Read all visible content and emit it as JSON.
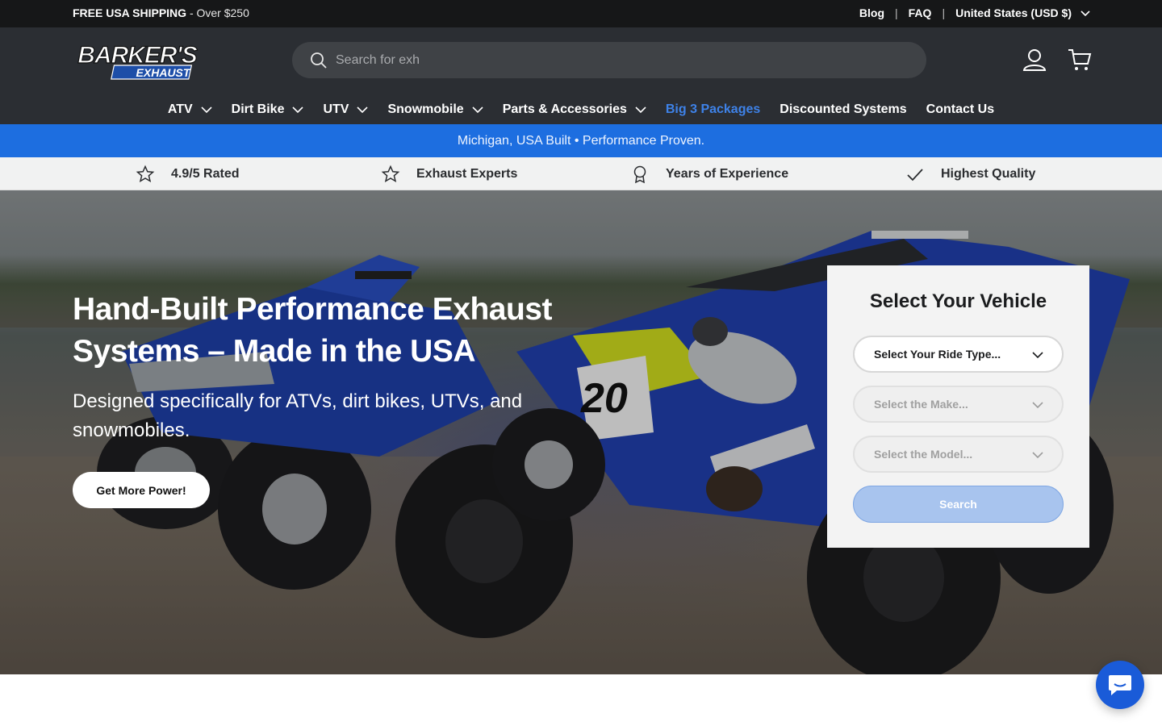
{
  "announcement": {
    "shipping_bold": "FREE USA SHIPPING",
    "shipping_rest": " - Over $250",
    "links": [
      "Blog",
      "FAQ"
    ],
    "region": "United States (USD $)"
  },
  "header": {
    "logo_top": "BARKER'S",
    "logo_bottom": "EXHAUST",
    "search_placeholder": "Search for exh",
    "account_icon": "user-icon",
    "cart_icon": "cart-icon"
  },
  "nav": {
    "items": [
      {
        "label": "ATV",
        "dropdown": true
      },
      {
        "label": "Dirt Bike",
        "dropdown": true
      },
      {
        "label": "UTV",
        "dropdown": true
      },
      {
        "label": "Snowmobile",
        "dropdown": true
      },
      {
        "label": "Parts & Accessories",
        "dropdown": true
      },
      {
        "label": "Big 3 Packages",
        "dropdown": false
      },
      {
        "label": "Discounted Systems",
        "dropdown": false
      },
      {
        "label": "Contact Us",
        "dropdown": false
      }
    ],
    "accent_color": "#3e82e8"
  },
  "banner": {
    "text": "Michigan, USA Built • Performance Proven.",
    "color": "#1d6ee0"
  },
  "trust": {
    "items": [
      {
        "icon": "star-icon",
        "label": "4.9/5 Rated"
      },
      {
        "icon": "star-icon",
        "label": "Exhaust Experts"
      },
      {
        "icon": "award-icon",
        "label": "Years of Experience"
      },
      {
        "icon": "check-icon",
        "label": "Highest Quality"
      }
    ]
  },
  "hero": {
    "heading": "Hand-Built Performance Exhaust Systems – Made in the USA",
    "subheading": "Designed specifically for ATVs, dirt bikes, UTVs, and snowmobiles.",
    "cta_label": "Get More Power!",
    "plate_number": "20"
  },
  "selector": {
    "title": "Select Your Vehicle",
    "ride_type": "Select Your Ride Type...",
    "make": "Select the Make...",
    "model": "Select the Model...",
    "search_label": "Search"
  },
  "chat": {
    "icon": "chat-icon"
  }
}
